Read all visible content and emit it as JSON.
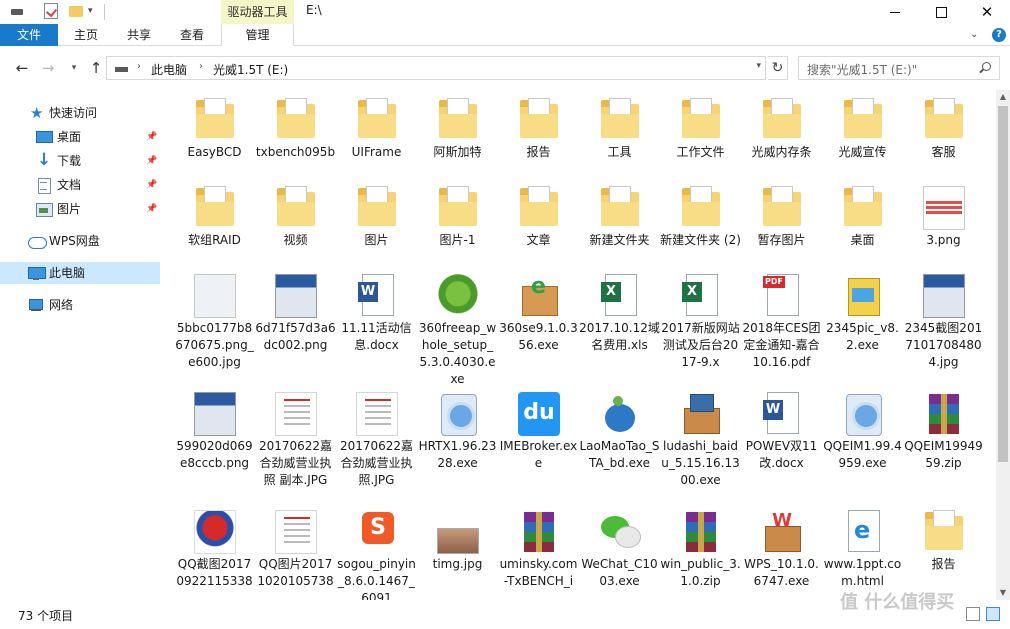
{
  "title_bar": {
    "context_group": "驱动器工具",
    "window_title": "E:\\",
    "close_glyph": "✕"
  },
  "ribbon": {
    "tabs": [
      "文件",
      "主页",
      "共享",
      "查看",
      "管理"
    ],
    "help": "?"
  },
  "address": {
    "crumbs": [
      "此电脑",
      "光威1.5T (E:)"
    ],
    "search_placeholder": "搜索\"光威1.5T (E:)\""
  },
  "nav": {
    "items": [
      {
        "label": "快速访问",
        "icon": "star-icon"
      },
      {
        "label": "桌面",
        "icon": "desktop-icon",
        "pinned": true
      },
      {
        "label": "下载",
        "icon": "download-icon",
        "pinned": true
      },
      {
        "label": "文档",
        "icon": "document-icon",
        "pinned": true
      },
      {
        "label": "图片",
        "icon": "pictures-icon",
        "pinned": true
      },
      {
        "label": "WPS网盘",
        "icon": "cloud-icon"
      },
      {
        "label": "此电脑",
        "icon": "computer-icon",
        "selected": true
      },
      {
        "label": "网络",
        "icon": "network-icon"
      }
    ]
  },
  "files": {
    "row1": [
      {
        "name": "EasyBCD",
        "icon": "folder-icon"
      },
      {
        "name": "txbench095b",
        "icon": "folder-icon"
      },
      {
        "name": "UIFrame",
        "icon": "folder-icon"
      },
      {
        "name": "阿斯加特",
        "icon": "folder-icon"
      },
      {
        "name": "报告",
        "icon": "folder-icon"
      },
      {
        "name": "工具",
        "icon": "folder-icon"
      },
      {
        "name": "工作文件",
        "icon": "folder-icon"
      },
      {
        "name": "光威内存条",
        "icon": "folder-icon"
      },
      {
        "name": "光威宣传",
        "icon": "folder-icon"
      },
      {
        "name": "客服",
        "icon": "folder-icon"
      }
    ],
    "row2": [
      {
        "name": "软组RAID",
        "icon": "folder-icon"
      },
      {
        "name": "视频",
        "icon": "folder-icon"
      },
      {
        "name": "图片",
        "icon": "folder-icon"
      },
      {
        "name": "图片-1",
        "icon": "folder-icon"
      },
      {
        "name": "文章",
        "icon": "folder-icon"
      },
      {
        "name": "新建文件夹",
        "icon": "folder-icon"
      },
      {
        "name": "新建文件夹 (2)",
        "icon": "folder-icon"
      },
      {
        "name": "暂存图片",
        "icon": "folder-icon"
      },
      {
        "name": "桌面",
        "icon": "folder-icon"
      },
      {
        "name": "3.png",
        "icon": "image-icon"
      }
    ],
    "row3": [
      {
        "name": "5bbc0177b8670675.png_e600.jpg",
        "icon": "image-icon"
      },
      {
        "name": "6d71f57d3a6dc002.png",
        "icon": "image-icon"
      },
      {
        "name": "11.11活动信息.docx",
        "icon": "word-icon"
      },
      {
        "name": "360freeap_whole_setup_5.3.0.4030.exe",
        "icon": "app-icon"
      },
      {
        "name": "360se9.1.0.356.exe",
        "icon": "app-icon"
      },
      {
        "name": "2017.10.12域名费用.xls",
        "icon": "excel-icon"
      },
      {
        "name": "2017新版网站测试及后台2017-9.x",
        "icon": "excel-icon"
      },
      {
        "name": "2018年CES团定金通知-嘉合10.16.pdf",
        "icon": "pdf-icon"
      },
      {
        "name": "2345pic_v8.2.exe",
        "icon": "app-icon"
      },
      {
        "name": "2345截图20171017084804.jpg",
        "icon": "image-icon"
      }
    ],
    "row4": [
      {
        "name": "599020d069e8cccb.png",
        "icon": "image-icon"
      },
      {
        "name": "20170622嘉合劲威营业执照 副本.JPG",
        "icon": "image-icon"
      },
      {
        "name": "20170622嘉合劲威营业执照.JPG",
        "icon": "image-icon"
      },
      {
        "name": "HRTX1.96.2328.exe",
        "icon": "app-icon"
      },
      {
        "name": "IMEBroker.exe",
        "icon": "app-icon"
      },
      {
        "name": "LaoMaoTao_STA_bd.exe",
        "icon": "app-icon"
      },
      {
        "name": "ludashi_baidu_5.15.16.1300.exe",
        "icon": "app-icon"
      },
      {
        "name": "POWEV双11改.docx",
        "icon": "word-icon"
      },
      {
        "name": "QQEIM1.99.4959.exe",
        "icon": "app-icon"
      },
      {
        "name": "QQEIM1994959.zip",
        "icon": "archive-icon"
      }
    ],
    "row5": [
      {
        "name": "QQ截图20170922115338",
        "icon": "image-icon"
      },
      {
        "name": "QQ图片20171020105738",
        "icon": "image-icon"
      },
      {
        "name": "sogou_pinyin_8.6.0.1467_6091",
        "icon": "app-icon"
      },
      {
        "name": "timg.jpg",
        "icon": "image-icon"
      },
      {
        "name": "uminsky.com-TxBENCH_i",
        "icon": "archive-icon"
      },
      {
        "name": "WeChat_C1003.exe",
        "icon": "app-icon"
      },
      {
        "name": "win_public_3.1.0.zip",
        "icon": "archive-icon"
      },
      {
        "name": "WPS_10.1.0.6747.exe",
        "icon": "app-icon"
      },
      {
        "name": "www.1ppt.com.html",
        "icon": "html-icon"
      },
      {
        "name": "报告",
        "icon": "folder-icon"
      }
    ]
  },
  "status": {
    "count": "73 个项目"
  },
  "watermark": "值 什么值得买"
}
